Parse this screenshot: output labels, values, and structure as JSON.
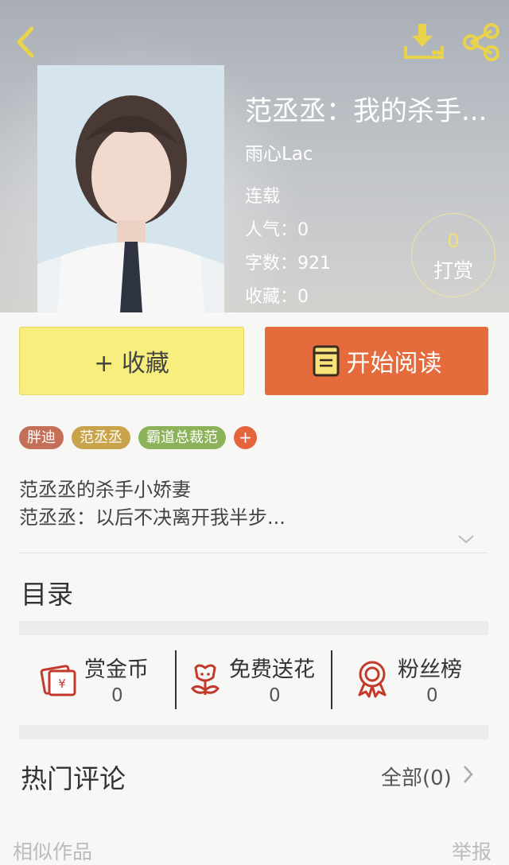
{
  "header": {
    "icons": {
      "back": "back-chevron-icon",
      "download": "download-icon",
      "share": "share-icon"
    },
    "accent_color": "#e9d34a"
  },
  "book": {
    "title": "范丞丞：我的杀手...",
    "author": "雨心Lac",
    "status": "连载",
    "popularity": "人气：0",
    "word_count": "字数：921",
    "favorites": "收藏：0"
  },
  "reward": {
    "count": "0",
    "label": "打赏"
  },
  "actions": {
    "favorite_label": "+ 收藏",
    "read_label": "开始阅读"
  },
  "tags": [
    {
      "label": "胖迪",
      "color": "#c46f58"
    },
    {
      "label": "范丞丞",
      "color": "#c9a34a"
    },
    {
      "label": "霸道总裁范",
      "color": "#8db35a"
    }
  ],
  "tag_add": "+",
  "description": {
    "line1": "范丞丞的杀手小娇妻",
    "line2": "范丞丞：以后不决离开我半步..."
  },
  "catalog_title": "目录",
  "stats": [
    {
      "label": "赏金币",
      "value": "0",
      "icon": "red-envelope-icon"
    },
    {
      "label": "免费送花",
      "value": "0",
      "icon": "flower-icon"
    },
    {
      "label": "粉丝榜",
      "value": "0",
      "icon": "ribbon-badge-icon"
    }
  ],
  "comments": {
    "title": "热门评论",
    "all_label": "全部(0)"
  },
  "footer": {
    "similar": "相似作品",
    "report": "举报"
  }
}
